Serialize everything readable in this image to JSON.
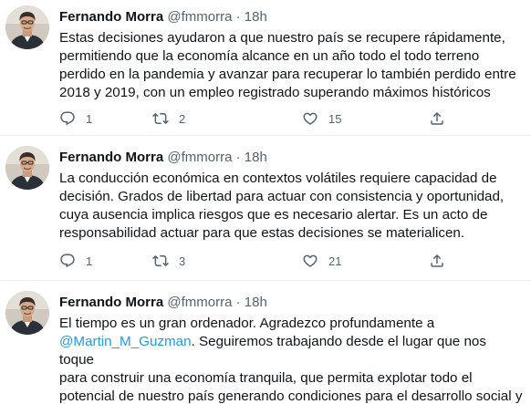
{
  "tweets": [
    {
      "name": "Fernando Morra",
      "handle": "@fmmorra",
      "sep": "·",
      "time": "18h",
      "text": "Estas decisiones ayudaron a que nuestro país se recupere rápidamente,\npermitiendo que la economía alcance en un año todo el todo terreno\nperdido en la pandemia y avanzar para recuperar lo también perdido entre\n2018 y 2019, con un empleo registrado superando máximos históricos",
      "replies": "1",
      "retweets": "2",
      "likes": "15"
    },
    {
      "name": "Fernando Morra",
      "handle": "@fmmorra",
      "sep": "·",
      "time": "18h",
      "text": "La conducción económica en contextos volátiles requiere capacidad de\ndecisión. Grados de libertad para actuar con consistencia y oportunidad,\ncuya ausencia implica riesgos que es necesario alertar. Es un acto de\nresponsabilidad actuar para que estas decisiones se materialicen.",
      "replies": "1",
      "retweets": "3",
      "likes": "21"
    },
    {
      "name": "Fernando Morra",
      "handle": "@fmmorra",
      "sep": "·",
      "time": "18h",
      "text_before": "El tiempo es un gran ordenador. Agradezco profundamente a\n",
      "mention": "@Martin_M_Guzman",
      "text_after": ". Seguiremos trabajando desde el lugar que nos toque\npara construir una economía tranquila, que permita explotar todo el\npotencial de nuestro país generando condiciones para el desarrollo social y\neconómico"
    }
  ],
  "icons": {
    "reply": "reply-icon",
    "retweet": "retweet-icon",
    "like": "heart-icon",
    "share": "share-icon"
  },
  "colors": {
    "text": "#0f1419",
    "secondary": "#536471",
    "link": "#1d9bf0",
    "divider": "#eff3f4"
  }
}
